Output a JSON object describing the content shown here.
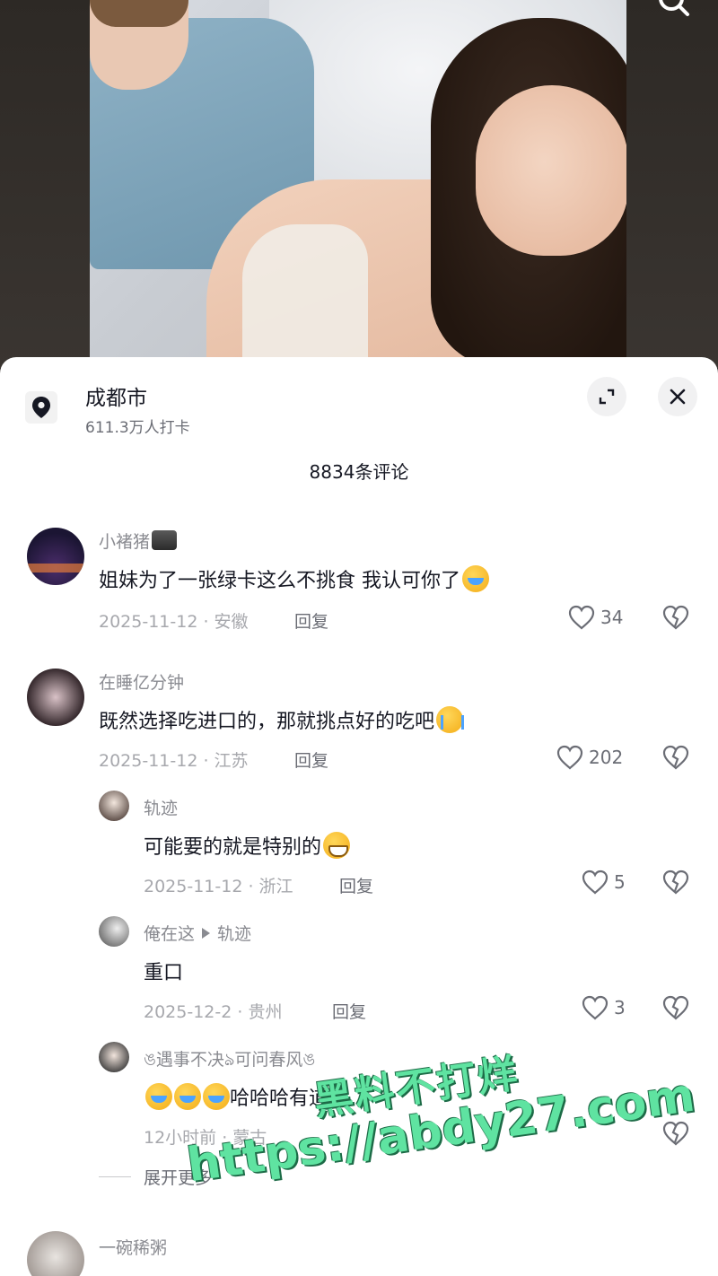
{
  "location": {
    "title": "成都市",
    "checkins": "611.3万人打卡"
  },
  "comments_header": "8834条评论",
  "comments": [
    {
      "username": "小褚猪",
      "text": "姐妹为了一张绿卡这么不挑食   我认可你了",
      "date_region": "2025-11-12 · 安徽",
      "reply_label": "回复",
      "likes": "34"
    },
    {
      "username": "在睡亿分钟",
      "text": "既然选择吃进口的，那就挑点好的吃吧",
      "date_region": "2025-11-12 · 江苏",
      "reply_label": "回复",
      "likes": "202"
    }
  ],
  "replies": [
    {
      "username": "轨迹",
      "text": "可能要的就是特别的",
      "date_region": "2025-11-12 · 浙江",
      "reply_label": "回复",
      "likes": "5"
    },
    {
      "username": "俺在这",
      "reply_to": "轨迹",
      "text": "重口",
      "date_region": "2025-12-2 · 贵州",
      "reply_label": "回复",
      "likes": "3"
    },
    {
      "username": "ঙ遇事不决ঌ可问春风ঙ",
      "text": "哈哈哈有道理",
      "date_region": "12小时前 · 蒙古",
      "reply_label": ""
    }
  ],
  "expand_more": "展开更多",
  "next_comment": {
    "username": "一碗稀粥"
  },
  "watermark": {
    "line1": "黑料不打烊",
    "line2": "https://abdy27.com"
  },
  "colors": {
    "sheet_bg": "#ffffff",
    "primary_text": "#161823",
    "secondary_text": "#8a8b91",
    "watermark": "#5fe3a1"
  }
}
